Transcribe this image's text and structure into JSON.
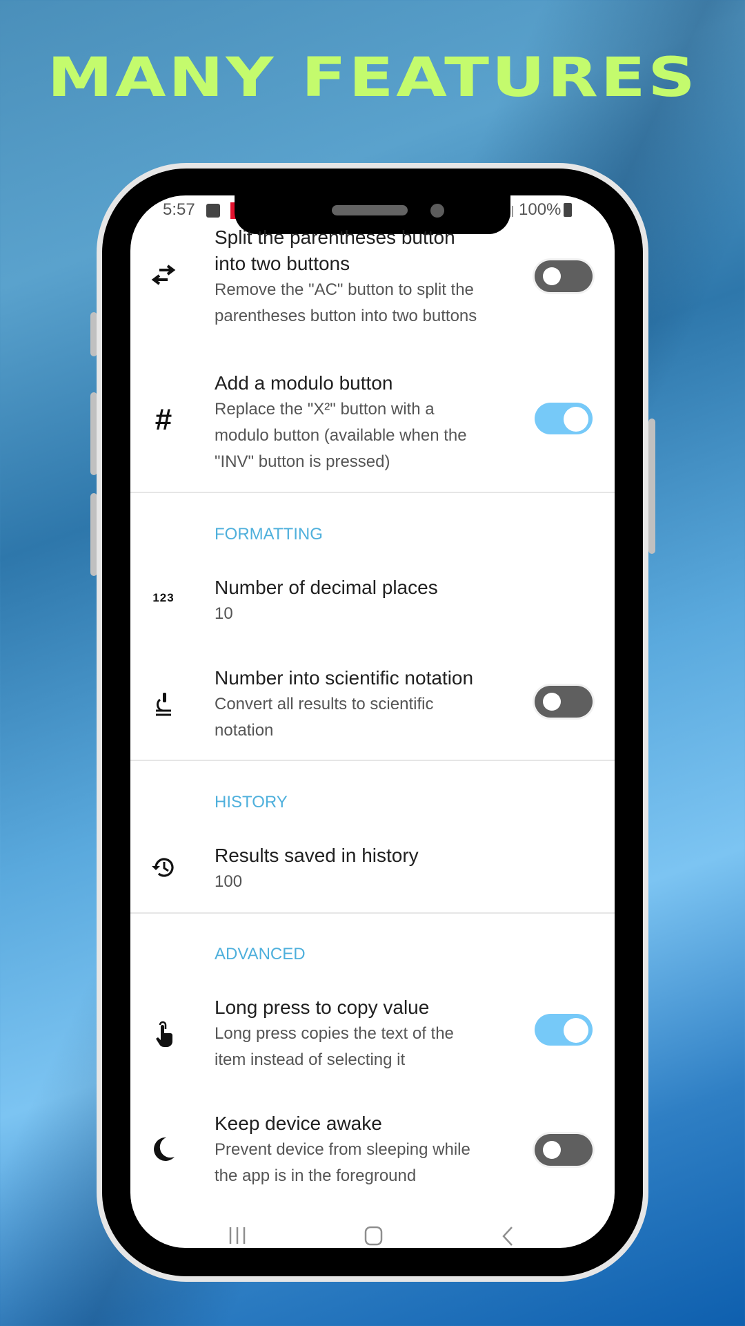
{
  "headline": "MANY FEATURES",
  "status_bar": {
    "time": "5:57",
    "battery": "100%"
  },
  "colors": {
    "headline": "#c4fb6d",
    "section_header": "#4fb0dc",
    "toggle_on": "#76c9f8",
    "toggle_off": "#5f5f5f"
  },
  "settings": {
    "split_parentheses": {
      "title_line1": "Split the parentheses button",
      "title_line2": "into two buttons",
      "desc_line1": "Remove the \"AC\" button to split the",
      "desc_line2": "parentheses button into two buttons",
      "icon": "swap-arrows-icon",
      "enabled": false
    },
    "modulo": {
      "title": "Add a modulo button",
      "desc_line1": "Replace the \"X²\" button with a",
      "desc_line2": "modulo button (available when the",
      "desc_line3": "\"INV\" button is pressed)",
      "icon": "hash-icon",
      "enabled": true
    },
    "formatting_header": "FORMATTING",
    "decimal_places": {
      "title": "Number of decimal places",
      "value": "10",
      "icon": "numbers-123-icon",
      "icon_text": "123"
    },
    "scientific": {
      "title": "Number into scientific notation",
      "desc_line1": "Convert all results to scientific",
      "desc_line2": "notation",
      "icon": "microscope-icon",
      "enabled": false
    },
    "history_header": "HISTORY",
    "history": {
      "title": "Results saved in history",
      "value": "100",
      "icon": "history-icon"
    },
    "advanced_header": "ADVANCED",
    "long_press": {
      "title": "Long press to copy value",
      "desc_line1": "Long press copies the text of the",
      "desc_line2": "item instead of selecting it",
      "icon": "touch-hand-icon",
      "enabled": true
    },
    "keep_awake": {
      "title": "Keep device awake",
      "desc_line1": "Prevent device from sleeping while",
      "desc_line2": "the app is in the foreground",
      "icon": "moon-icon",
      "enabled": false
    }
  },
  "nav_bar": {
    "recents": "recents-icon",
    "home": "home-icon",
    "back": "back-icon"
  }
}
